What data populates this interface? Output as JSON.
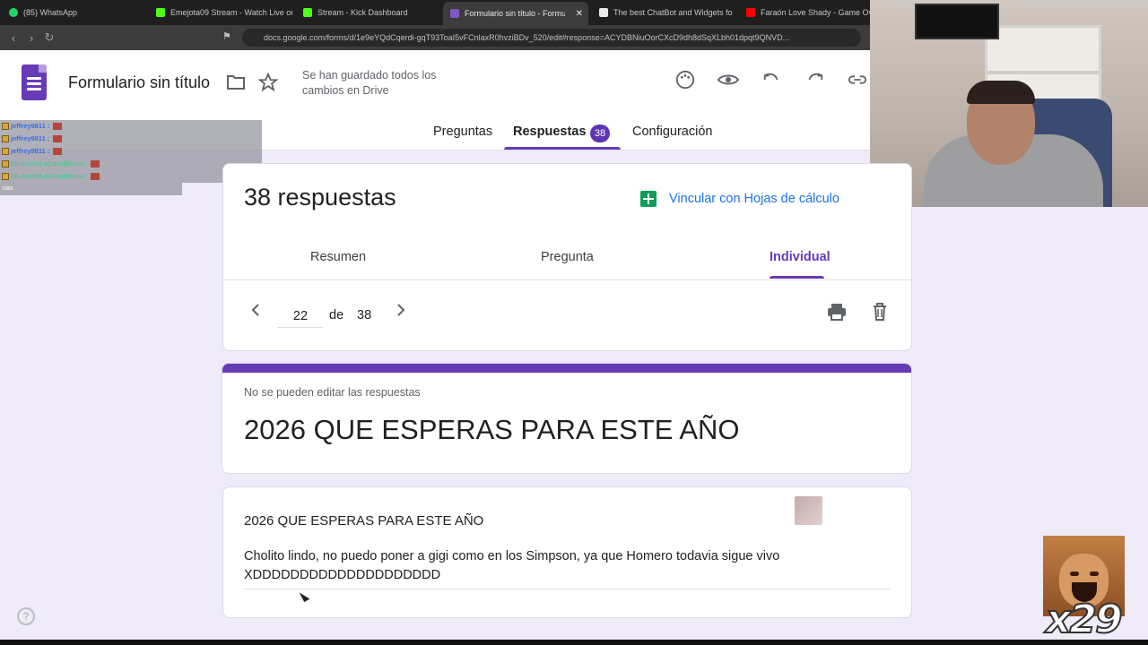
{
  "browser": {
    "tabs": [
      {
        "label": "(85) WhatsApp",
        "color": "#25d366"
      },
      {
        "label": "Emejota09 Stream - Watch Live on Ki",
        "color": "#53fc18"
      },
      {
        "label": "Stream - Kick Dashboard",
        "color": "#53fc18"
      },
      {
        "label": "Formulario sin título - Formulario",
        "color": "#7e57c2",
        "active": true
      },
      {
        "label": "The best ChatBot and Widgets fo",
        "color": "#e8eaed"
      },
      {
        "label": "Faraón Love Shady - Game Over Fa",
        "color": "#ff0000"
      }
    ],
    "url": "docs.google.com/forms/d/1e9eYQdCqerdi-gqT93ToaI5vFCnlaxR0hvziBDv_520/edit#response=ACYDBNiuOorCXcD9dh8dSqXLbh01dpqt9QNVD..."
  },
  "header": {
    "doc_title": "Formulario sin título",
    "save_status": "Se han guardado todos los cambios en Drive",
    "tabs": {
      "questions": "Preguntas",
      "responses": "Respuestas",
      "responses_count": "38",
      "settings": "Configuración"
    }
  },
  "chat": {
    "messages": [
      {
        "user": "jeffrey9811 :"
      },
      {
        "user": "jeffrey9811 :"
      },
      {
        "user": "jeffrey9811 :"
      },
      {
        "user": "ElLocoDeLaCasaBlanca :"
      },
      {
        "user": "ElLocoDeLaCasaBlanca :"
      }
    ],
    "last_fragment": "sias"
  },
  "responses": {
    "count_label": "38 respuestas",
    "sheets_link": "Vincular con Hojas de cálculo",
    "view_tabs": {
      "summary": "Resumen",
      "question": "Pregunta",
      "individual": "Individual"
    },
    "pager": {
      "current": "22",
      "of": "de",
      "total": "38"
    }
  },
  "form": {
    "no_edit_notice": "No se pueden editar las respuestas",
    "title": "2026 QUE ESPERAS PARA ESTE AÑO",
    "question": {
      "label": "2026 QUE ESPERAS PARA ESTE AÑO",
      "answer": "Cholito lindo, no puedo poner a gigi como en los Simpson, ya que Homero todavia sigue vivo XDDDDDDDDDDDDDDDDDDDD"
    }
  },
  "overlay": {
    "combo": "x29"
  },
  "colors": {
    "accent": "#673ab7",
    "link": "#1a73e8",
    "sheets": "#0f9d58"
  }
}
